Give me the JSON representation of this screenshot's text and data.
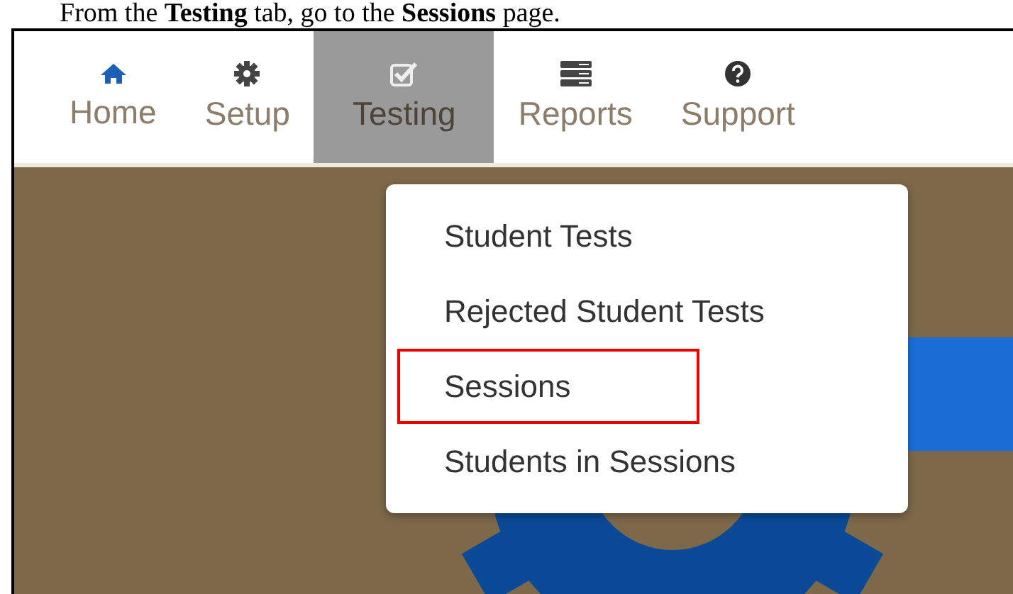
{
  "caption": "From the **Testing** tab, go to the **Sessions** page.",
  "nav": [
    {
      "label": "Home",
      "selected": false
    },
    {
      "label": "Setup",
      "selected": false
    },
    {
      "label": "Testing",
      "selected": true
    },
    {
      "label": "Reports",
      "selected": false
    },
    {
      "label": "Support",
      "selected": false
    }
  ],
  "menu": [
    {
      "label": "Student Tests",
      "highlighted": false
    },
    {
      "label": "Rejected Student Tests",
      "highlighted": false
    },
    {
      "label": "Sessions",
      "highlighted": true
    },
    {
      "label": "Students in Sessions",
      "highlighted": false
    }
  ]
}
